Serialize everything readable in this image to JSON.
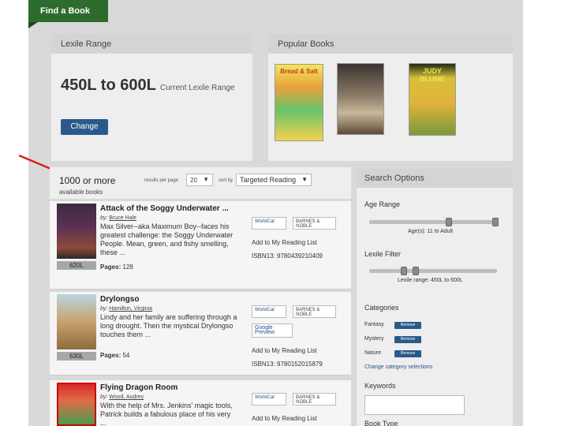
{
  "findbook_tab": "Find a Book",
  "lexile_panel": {
    "title": "Lexile Range",
    "range": "450L to 600L",
    "range_note": "Current Lexile Range",
    "change_button": "Change"
  },
  "popular_panel": {
    "title": "Popular Books",
    "covers": [
      {
        "text": "Bread & Salt"
      },
      {
        "text": ""
      },
      {
        "text": "JUDY BLUME"
      }
    ]
  },
  "results": {
    "count": "1000 or more",
    "count_caption": "available books",
    "items_per_page_label": "results per page",
    "items_per_page_value": "20",
    "sort_by_label": "sort by",
    "sort_by_value": "Targeted Reading"
  },
  "books": [
    {
      "title": "Attack of the Soggy Underwater ...",
      "author_prefix": "by:",
      "author": "Bruce Hale",
      "description": "Max Silver--aka Maximum Boy--faces his greatest challenge: the Soggy Underwater People. Mean, green, and fishy smelling, these ...",
      "pages_label": "Pages:",
      "pages": "128",
      "lexile": "620L",
      "worldcat": "WorldCat",
      "bn": "BARNES & NOBLE",
      "reading_list": "Add to My Reading List",
      "isbn": "ISBN13: 9780439210409"
    },
    {
      "title": "Drylongso",
      "author_prefix": "by:",
      "author": "Hamilton, Virginia",
      "description": "Lindy and her family are suffering through a long drought. Then the mystical Drylongso touches them ...",
      "pages_label": "Pages:",
      "pages": "54",
      "lexile": "630L",
      "worldcat": "WorldCat",
      "bn": "BARNES & NOBLE",
      "google": "Google Preview",
      "reading_list": "Add to My Reading List",
      "isbn": "ISBN13: 9780152015879"
    },
    {
      "title": "Flying Dragon Room",
      "author_prefix": "by:",
      "author": "Wood, Audrey",
      "description": "With the help of Mrs. Jenkins' magic tools, Patrick builds a fabulous place of his very ...",
      "worldcat": "WorldCat",
      "bn": "BARNES & NOBLE",
      "reading_list": "Add to My Reading List"
    }
  ],
  "search_options": {
    "title": "Search Options",
    "age_range_label": "Age Range",
    "age_caption": "Age(s): 11 to Adult",
    "lexile_filter_label": "Lexile Filter",
    "lexile_caption": "Lexile range: 450L to 600L",
    "categories_label": "Categories",
    "categories": [
      {
        "name": "Fantasy",
        "button": "Remove"
      },
      {
        "name": "Mystery",
        "button": "Remove"
      },
      {
        "name": "Nature",
        "button": "Remove"
      }
    ],
    "change_categories": "Change category selections",
    "keywords_label": "Keywords",
    "book_type_label": "Book Type"
  },
  "colors": {
    "accent_green": "#2e6b2e",
    "button_blue": "#2a5a8c",
    "arrow_red": "#d9201a"
  }
}
